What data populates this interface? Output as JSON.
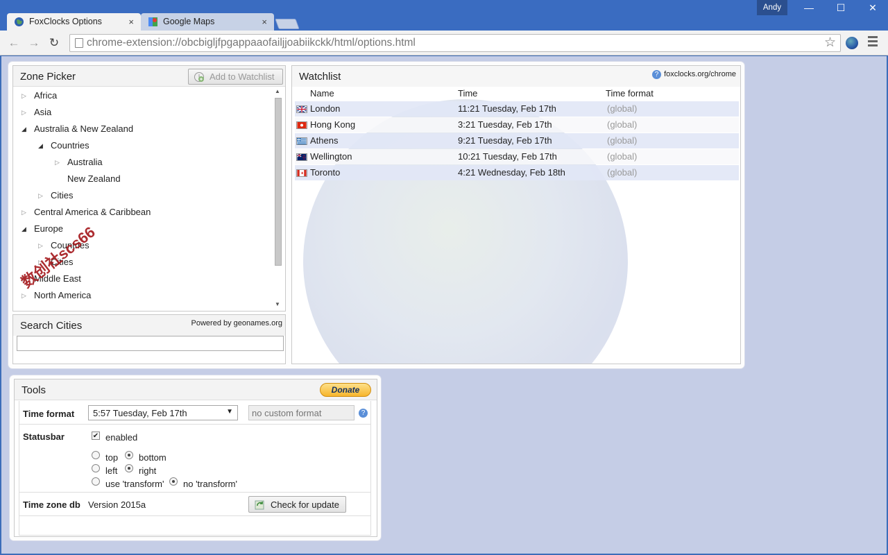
{
  "browser": {
    "user_name": "Andy",
    "tabs": [
      {
        "title": "FoxClocks Options",
        "close": "×"
      },
      {
        "title": "Google Maps",
        "close": "×"
      }
    ],
    "url": "chrome-extension://obcbigljfpgappaaofailjjoabiikckk/html/options.html"
  },
  "zone_picker": {
    "title": "Zone Picker",
    "add_button": "Add to Watchlist",
    "tree": [
      {
        "label": "Africa",
        "expander": "▷"
      },
      {
        "label": "Asia",
        "expander": "▷"
      },
      {
        "label": "Australia & New Zealand",
        "expander": "◢"
      },
      {
        "label": "Countries",
        "expander": "◢"
      },
      {
        "label": "Australia",
        "expander": "▷"
      },
      {
        "label": "New Zealand",
        "expander": ""
      },
      {
        "label": "Cities",
        "expander": "▷"
      },
      {
        "label": "Central America & Caribbean",
        "expander": "▷"
      },
      {
        "label": "Europe",
        "expander": "◢"
      },
      {
        "label": "Countries",
        "expander": "▷"
      },
      {
        "label": "Cities",
        "expander": "▷"
      },
      {
        "label": "Middle East",
        "expander": "▷"
      },
      {
        "label": "North America",
        "expander": "▷"
      }
    ],
    "watermark": "数创社scs66"
  },
  "search_cities": {
    "title": "Search Cities",
    "powered_by": "Powered by geonames.org",
    "input_value": ""
  },
  "watchlist": {
    "title": "Watchlist",
    "help_link": "foxclocks.org/chrome",
    "columns": [
      "Name",
      "Time",
      "Time format"
    ],
    "rows": [
      {
        "name": "London",
        "time": "11:21 Tuesday, Feb 17th",
        "format": "(global)",
        "flag": "uk"
      },
      {
        "name": "Hong Kong",
        "time": "3:21 Tuesday, Feb 17th",
        "format": "(global)",
        "flag": "hk"
      },
      {
        "name": "Athens",
        "time": "9:21 Tuesday, Feb 17th",
        "format": "(global)",
        "flag": "gr"
      },
      {
        "name": "Wellington",
        "time": "10:21 Tuesday, Feb 17th",
        "format": "(global)",
        "flag": "nz"
      },
      {
        "name": "Toronto",
        "time": "4:21 Wednesday, Feb 18th",
        "format": "(global)",
        "flag": "ca"
      }
    ]
  },
  "tools": {
    "title": "Tools",
    "donate": "Donate",
    "time_format_label": "Time format",
    "time_format_value": "5:57 Tuesday, Feb 17th",
    "custom_format_placeholder": "no custom format",
    "statusbar_label": "Statusbar",
    "enabled_label": "enabled",
    "enabled_checked": true,
    "radio_labels": {
      "top": "top",
      "bottom": "bottom",
      "left": "left",
      "right": "right",
      "use_transform": "use 'transform'",
      "no_transform": "no 'transform'"
    },
    "time_zone_db_label": "Time zone db",
    "time_zone_db_version": "Version 2015a",
    "check_update": "Check for update"
  },
  "colors": {
    "titlebar": "#3a6cc1",
    "page_bg": "#c5cde6",
    "donate": "#f7b52c"
  }
}
